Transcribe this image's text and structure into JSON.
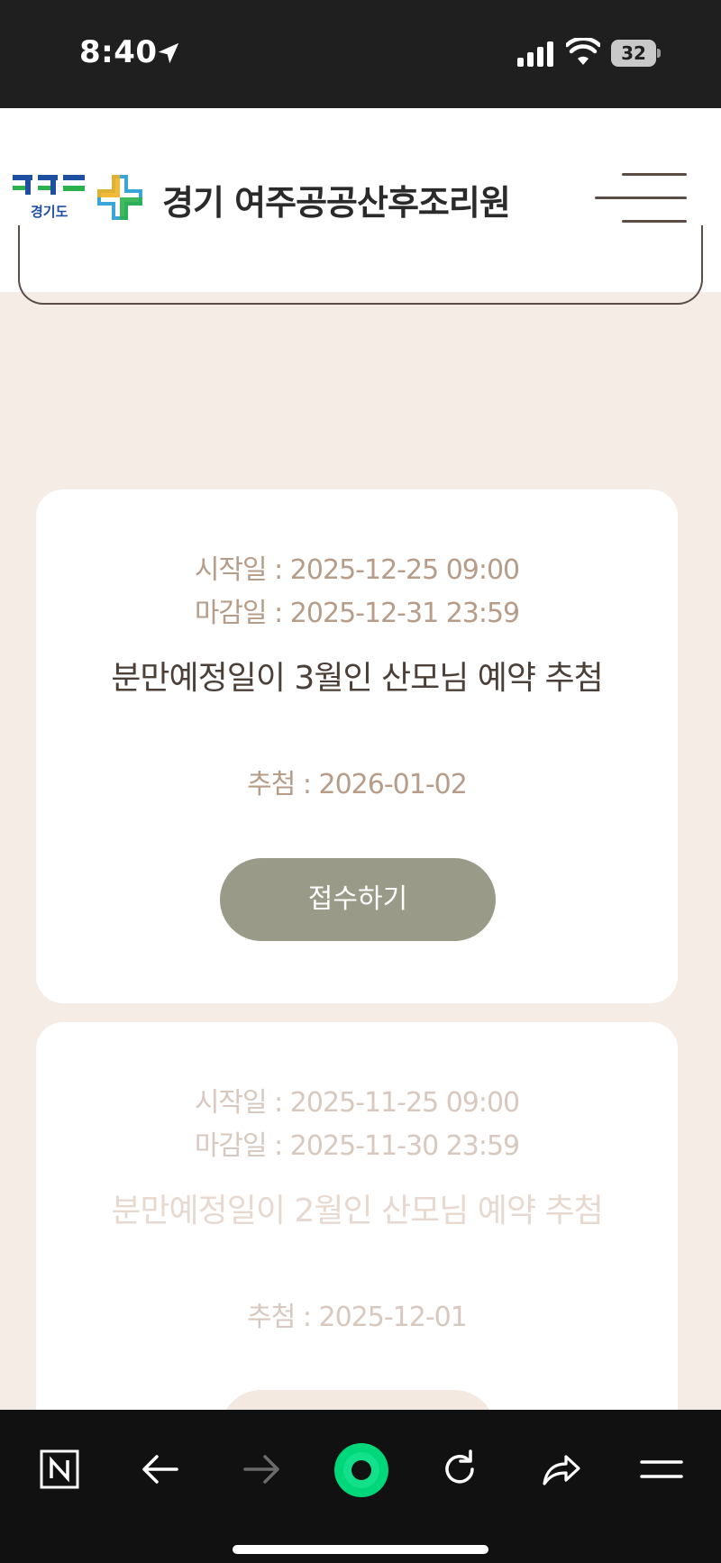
{
  "status_bar": {
    "time": "8:40",
    "battery": "32",
    "icons": [
      "location-arrow-icon",
      "cellular-signal-icon",
      "wifi-icon",
      "battery-icon"
    ]
  },
  "header": {
    "logo_label": "경기도",
    "title": "경기 여주공공산후조리원",
    "icons": [
      "gyeonggi-logo-icon",
      "medical-cross-logo-icon",
      "hamburger-menu-icon"
    ]
  },
  "cards": [
    {
      "start": "시작일 : 2025-12-25 09:00",
      "end": "마감일 : 2025-12-31 23:59",
      "title": "분만예정일이 3월인 산모님 예약 추첨",
      "draw": "추첨 : 2026-01-02",
      "button": "접수하기"
    },
    {
      "start": "시작일 : 2025-11-25 09:00",
      "end": "마감일 : 2025-11-30 23:59",
      "title": "분만예정일이 2월인 산모님 예약 추첨",
      "draw": "추첨 : 2025-12-01"
    }
  ],
  "browser_toolbar": {
    "icons": [
      "naver-n-icon",
      "back-arrow-icon",
      "forward-arrow-icon",
      "green-circle-home-icon",
      "reload-icon",
      "share-icon",
      "menu-icon"
    ],
    "colors": {
      "accent": "#00d67a",
      "toolbar_bg": "#111111"
    }
  },
  "colors": {
    "page_bg": "#f5ece6",
    "button_bg": "#999a87",
    "muted_text": "#b79c88"
  }
}
